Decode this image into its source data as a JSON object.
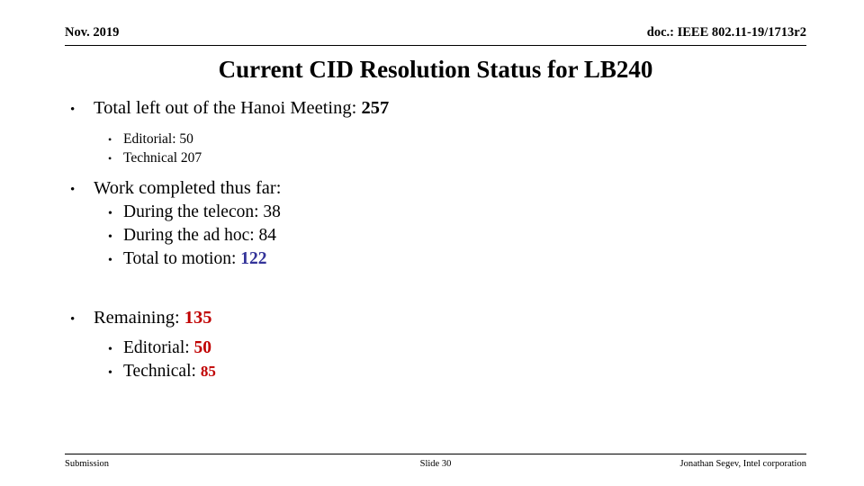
{
  "header": {
    "date": "Nov. 2019",
    "doc_id": "doc.: IEEE 802.11-19/1713r2"
  },
  "title": "Current CID Resolution Status for LB240",
  "bullet_glyph": "•",
  "content": {
    "group1": {
      "main_label": "Total left out of the Hanoi Meeting: ",
      "main_value": "257",
      "sub": [
        {
          "label": "Editorial: 50"
        },
        {
          "label": "Technical 207"
        }
      ]
    },
    "group2": {
      "main_label": "Work completed thus far:",
      "sub": [
        {
          "label": "During the telecon: 38",
          "value": "",
          "color": ""
        },
        {
          "label": "During the ad hoc: 84",
          "value": "",
          "color": ""
        },
        {
          "label": "Total to motion: ",
          "value": "122",
          "color": "#333399"
        }
      ]
    },
    "group3": {
      "main_label": "Remaining: ",
      "main_value": "135",
      "main_value_color": "#C00000",
      "sub": [
        {
          "label": "Editorial: ",
          "value": "50",
          "color": "#C00000"
        },
        {
          "label": "Technical: ",
          "value": "85",
          "color": "#C00000"
        }
      ]
    }
  },
  "footer": {
    "left": "Submission",
    "center": "Slide 30",
    "right": "Jonathan Segev, Intel corporation"
  },
  "colors": {
    "text": "#000000",
    "blue_accent": "#333399",
    "red_accent": "#C00000",
    "background": "#ffffff"
  }
}
